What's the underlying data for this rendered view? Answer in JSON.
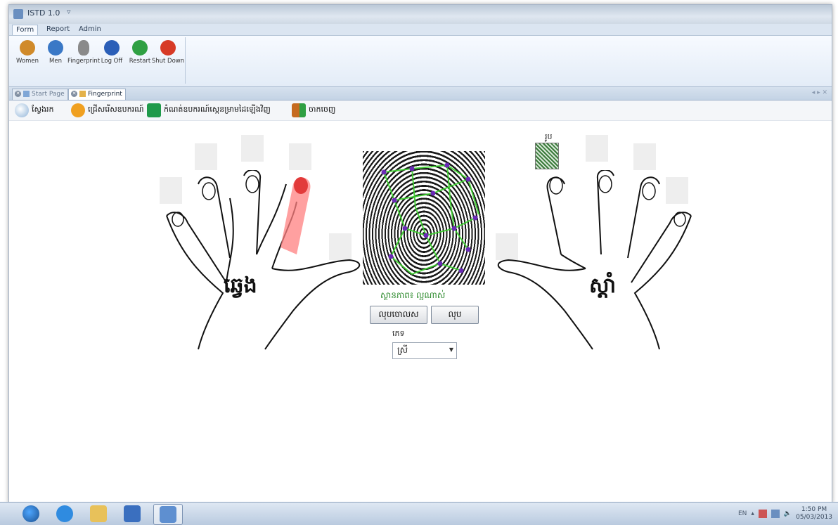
{
  "window": {
    "title": "ISTD 1.0",
    "title_arrow": "▿"
  },
  "ribbon": {
    "tabs": [
      "Form",
      "Report",
      "Admin"
    ],
    "buttons": [
      {
        "label": "Women",
        "icon": "woman-user-icon",
        "color": "#d08a2a"
      },
      {
        "label": "Men",
        "icon": "man-user-icon",
        "color": "#3a78c6"
      },
      {
        "label": "Fingerprint",
        "icon": "fingerprint-icon",
        "color": "#8a8a8a"
      },
      {
        "label": "Log Off",
        "icon": "log-off-icon",
        "color": "#2b5fb8"
      },
      {
        "label": "Restart",
        "icon": "restart-icon",
        "color": "#2fa043"
      },
      {
        "label": "Shut Down",
        "icon": "power-icon",
        "color": "#d73a26"
      }
    ]
  },
  "doc_tabs": {
    "items": [
      {
        "label": "Start Page",
        "active": false
      },
      {
        "label": "Fingerprint",
        "active": true
      }
    ],
    "nav": "◂ ▸ ✕"
  },
  "toolbar": {
    "items": [
      {
        "label": "ស្វែងរក",
        "icon": "search-icon",
        "color": "#c9d9ea"
      },
      {
        "label": "ជ្រើសរើសឧបករណ៍",
        "icon": "refresh-icon",
        "color": "#f0a020"
      },
      {
        "label": "កំណត់ឧបករណ៍ស្កេនម្រាមដៃឡើងវិញ",
        "icon": "reset-icon",
        "color": "#1f9a4a"
      },
      {
        "label": "ចាកចេញ",
        "icon": "exit-icon",
        "color": "#d8862a"
      }
    ]
  },
  "main": {
    "left_hand_label": "ឆ្វេង",
    "right_hand_label": "ស្តាំ",
    "status_text": "ស្ថានភាព៖ ល្អណាស់",
    "rescan_button": "លុបចោលស",
    "delete_button": "លុប",
    "gender_label": "ភេទ",
    "gender_value": "ស្រី",
    "photo_label": "រូប"
  },
  "taskbar": {
    "lang": "EN",
    "time": "1:50 PM",
    "date": "05/03/2013"
  }
}
